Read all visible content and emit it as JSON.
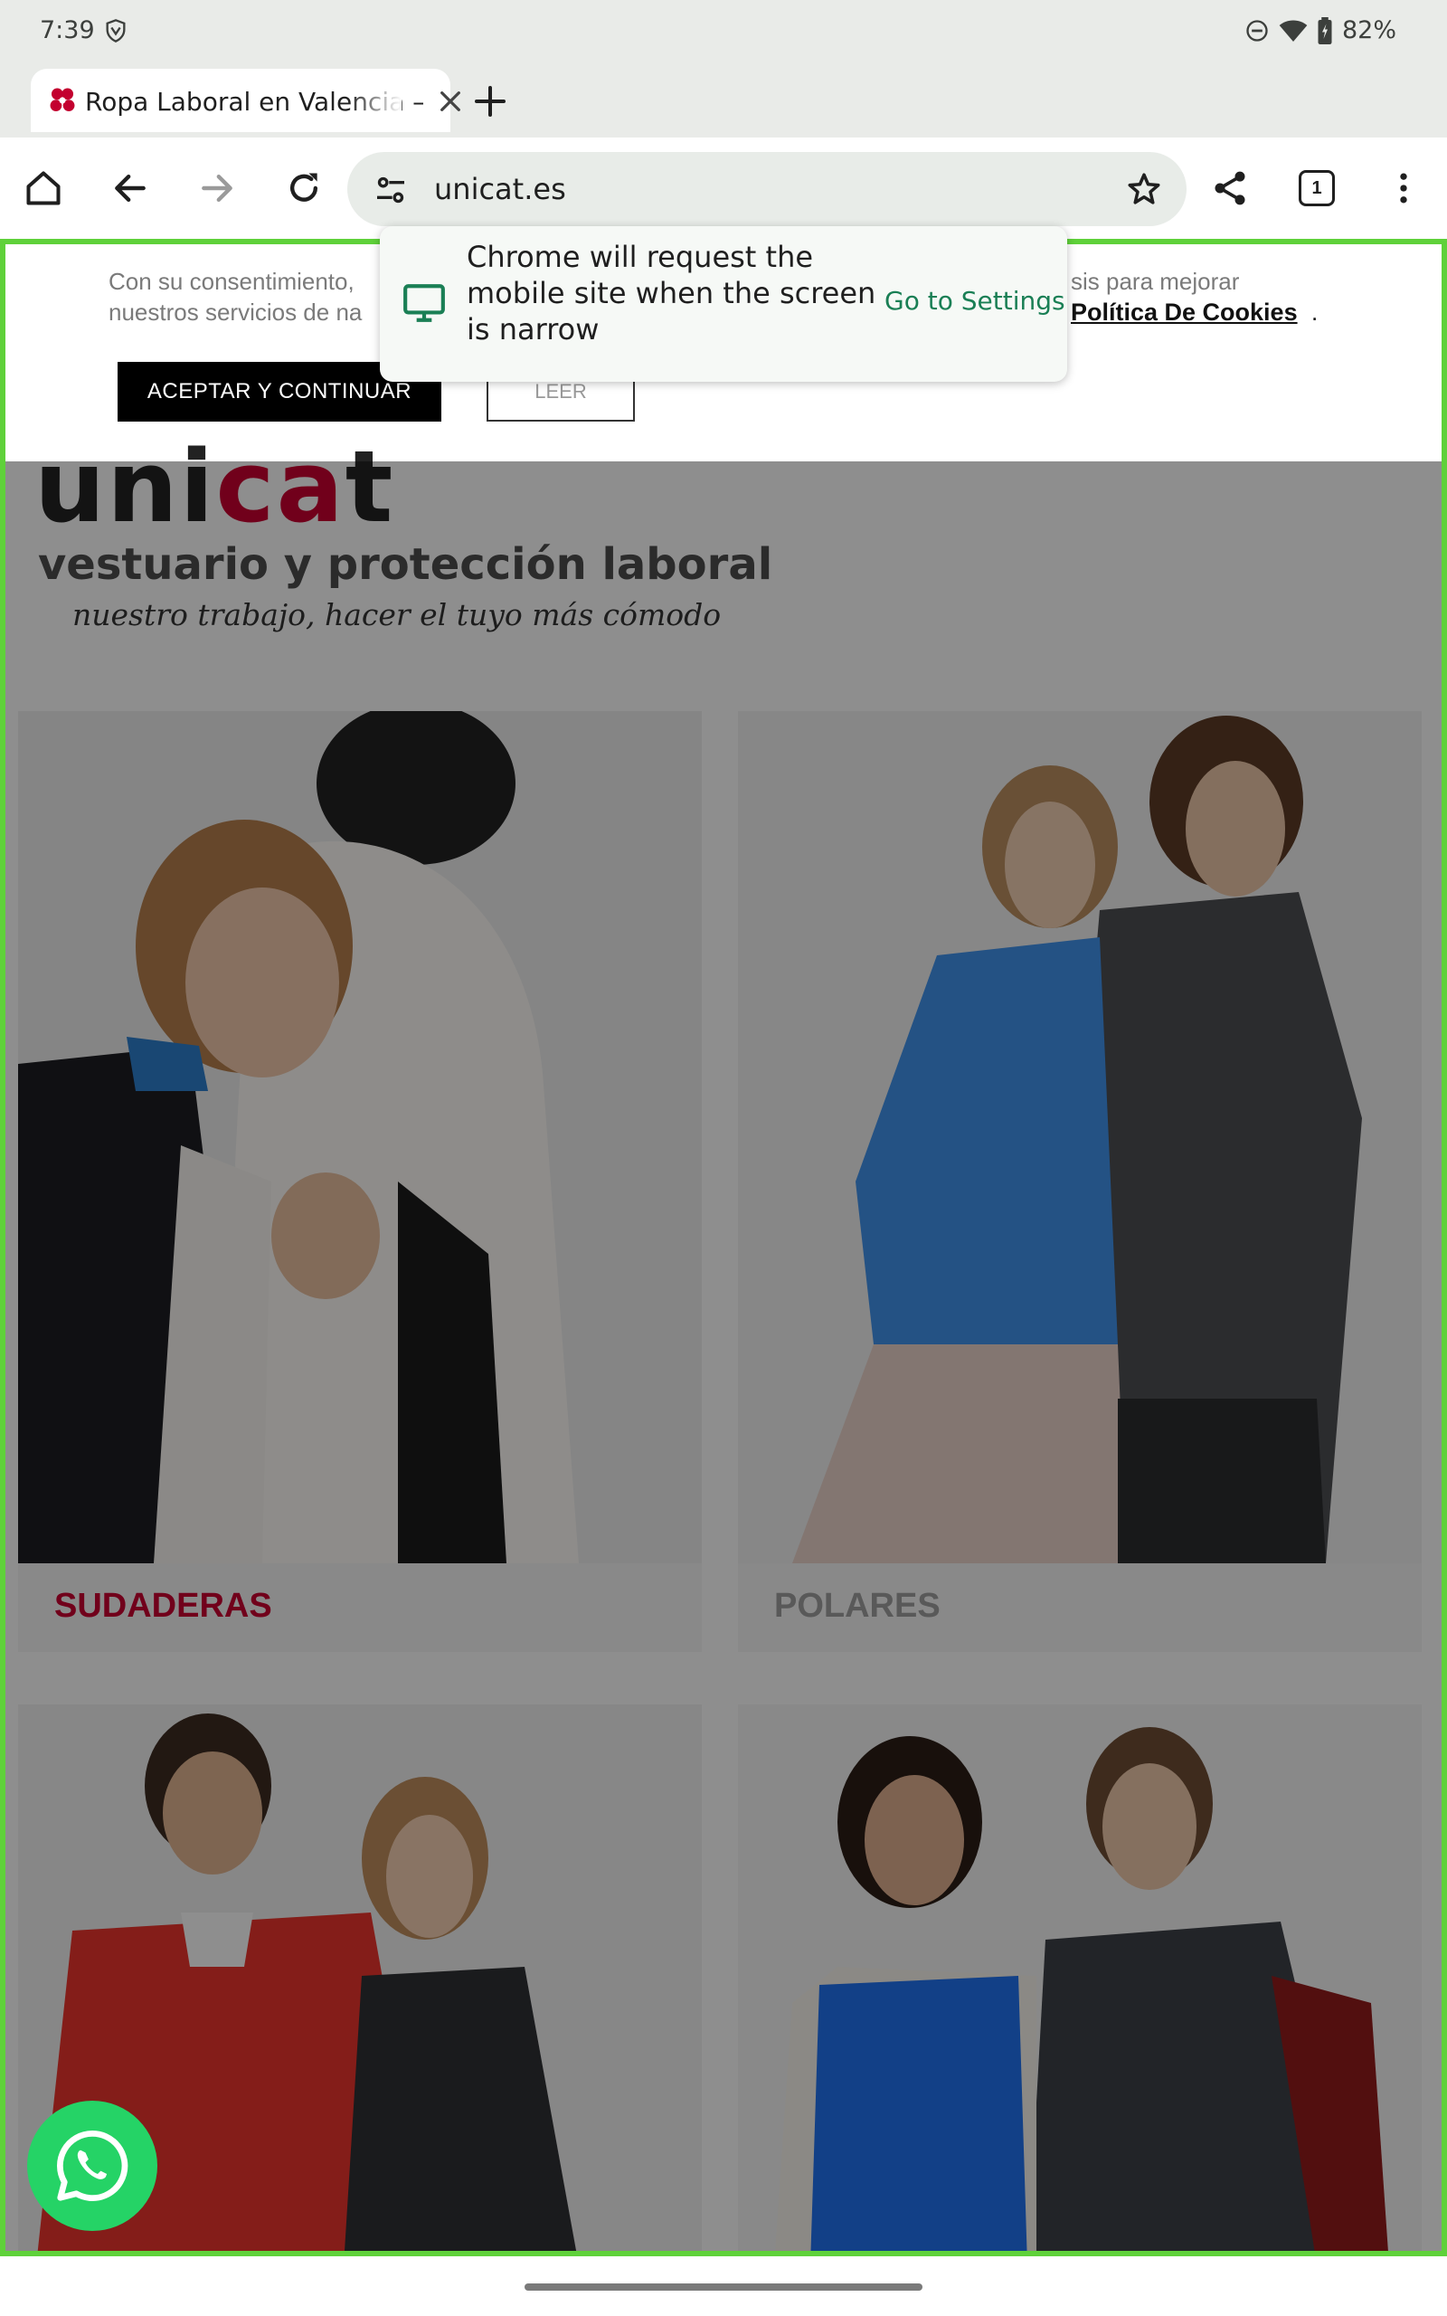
{
  "status_bar": {
    "time": "7:39",
    "battery": "82%",
    "icons": [
      "vpn-icon",
      "dnd-icon",
      "wifi-icon",
      "battery-icon"
    ]
  },
  "browser": {
    "tab": {
      "title": "Ropa Laboral en Valencia –",
      "favicon": "unicat-flower-icon"
    },
    "toolbar": {
      "icons": [
        "home-icon",
        "back-icon",
        "forward-icon",
        "reload-icon",
        "site-settings-icon",
        "bookmark-star-icon",
        "share-icon",
        "tab-switcher-icon",
        "menu-icon"
      ],
      "url": "unicat.es",
      "tab_count": "1"
    },
    "message": {
      "text": "Chrome will request the mobile site when the screen is narrow",
      "action": "Go to Settings",
      "icon": "desktop-icon"
    }
  },
  "cookie_banner": {
    "text_left_line1": "Con su consentimiento,",
    "text_left_line2": "nuestros servicios de na",
    "text_right_line1": "sis para mejorar",
    "link": "Política De Cookies",
    "link_suffix": ".",
    "accept_label": "ACEPTAR Y CONTINUAR",
    "read_label": "LEER"
  },
  "page": {
    "logo_word_dark": "uni",
    "logo_word_red": "ca",
    "logo_word_dark2": "t",
    "logo_subtitle": "vestuario y protección laboral",
    "logo_tagline": "nuestro trabajo, hacer el tuyo más cómodo",
    "products": [
      {
        "label": "SUDADERAS"
      },
      {
        "label": "POLARES"
      }
    ]
  },
  "colors": {
    "brand_red": "#c3002f",
    "whatsapp_green": "#25d366",
    "settings_link": "#1a7f55",
    "focus_outline": "#5fd13a"
  },
  "floating": {
    "whatsapp_icon": "whatsapp-icon"
  }
}
